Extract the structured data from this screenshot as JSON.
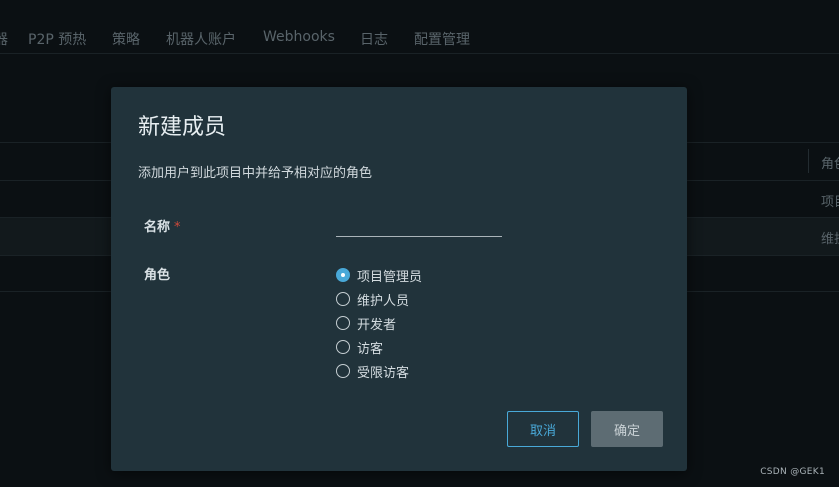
{
  "background": {
    "tabs": [
      {
        "label": "器"
      },
      {
        "label": "P2P 预热"
      },
      {
        "label": "策略"
      },
      {
        "label": "机器人账户"
      },
      {
        "label": "Webhooks"
      },
      {
        "label": "日志"
      },
      {
        "label": "配置管理"
      }
    ],
    "table": {
      "header_partial": "角色",
      "rows_partial": [
        "项目",
        "维护"
      ]
    }
  },
  "modal": {
    "title": "新建成员",
    "description": "添加用户到此项目中并给予相对应的角色",
    "name_label": "名称",
    "required_mark": "*",
    "name_value": "",
    "role_label": "角色",
    "roles": [
      {
        "label": "项目管理员",
        "checked": true
      },
      {
        "label": "维护人员",
        "checked": false
      },
      {
        "label": "开发者",
        "checked": false
      },
      {
        "label": "访客",
        "checked": false
      },
      {
        "label": "受限访客",
        "checked": false
      }
    ],
    "cancel_label": "取消",
    "ok_label": "确定"
  },
  "watermark": "CSDN @GEK1",
  "colors": {
    "accent": "#49a9d8",
    "modal_bg": "#21333b",
    "page_bg": "#0b1013",
    "required": "#d0493a",
    "disabled_button": "#5d6c73"
  }
}
